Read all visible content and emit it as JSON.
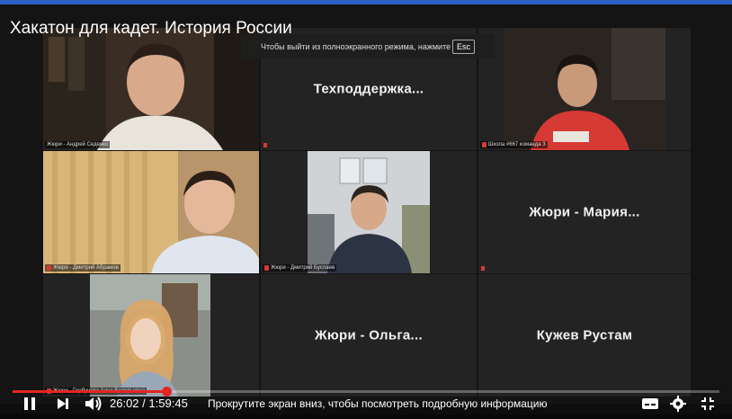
{
  "video_title": "Хакатон для кадет. История России",
  "fullscreen_notice": {
    "text": "Чтобы выйти из полноэкранного режима, нажмите",
    "key": "Esc"
  },
  "tiles": [
    {
      "label": "Жюри - Андрей Седенко",
      "type": "video"
    },
    {
      "big_name": "Техподдержка...",
      "type": "name"
    },
    {
      "label": "Школа #667 команда 3",
      "type": "video"
    },
    {
      "label": "Жюри - Дмитрий Абрамов",
      "type": "video"
    },
    {
      "label": "Жюри - Дмитрий Буслаев",
      "type": "video"
    },
    {
      "big_name": "Жюри - Мария...",
      "type": "name"
    },
    {
      "label": "Жюри - Горбунова Анна Валерьевна",
      "type": "video"
    },
    {
      "big_name": "Жюри - Ольга...",
      "type": "name"
    },
    {
      "big_name": "Кужев Рустам",
      "type": "name"
    }
  ],
  "player": {
    "current_time": "26:02",
    "separator": "/",
    "duration": "1:59:45",
    "progress_fraction": 0.217,
    "scroll_hint": "Прокрутите экран вниз, чтобы посмотреть подробную информацию",
    "accent_color": "#e52521"
  },
  "icons": [
    "play-pause-icon",
    "next-icon",
    "volume-icon",
    "subtitles-icon",
    "settings-icon",
    "exit-fullscreen-icon"
  ]
}
